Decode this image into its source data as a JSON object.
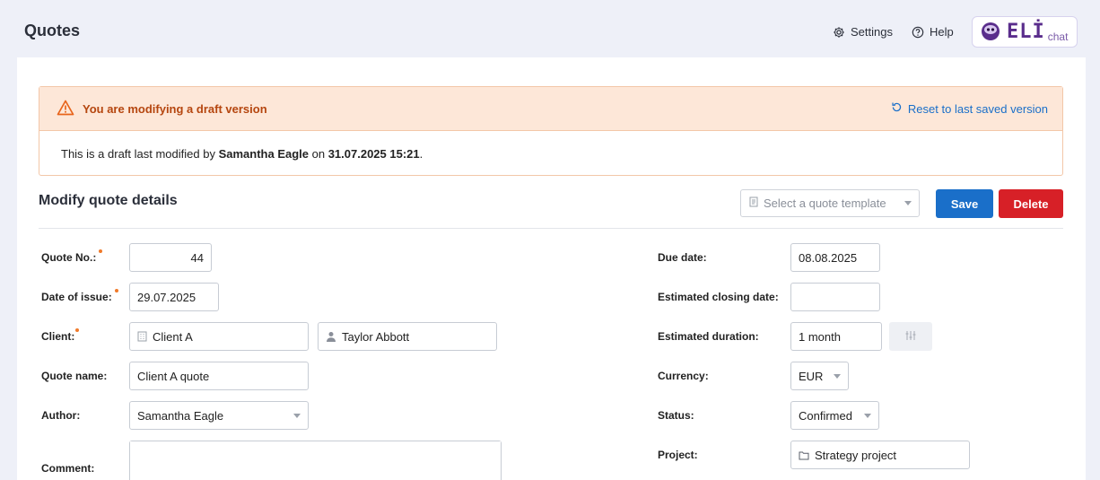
{
  "header": {
    "title": "Quotes",
    "settings_label": "Settings",
    "help_label": "Help",
    "eli_logo": "ELİ",
    "eli_chat": "chat"
  },
  "banner": {
    "title": "You are modifying a draft version",
    "reset_label": "Reset to last saved version",
    "body_prefix": "This is a draft last modified by ",
    "author": "Samantha Eagle",
    "body_mid": " on ",
    "timestamp": "31.07.2025 15:21",
    "body_suffix": "."
  },
  "section": {
    "title": "Modify quote details",
    "template_placeholder": "Select a quote template",
    "save_label": "Save",
    "delete_label": "Delete"
  },
  "form_left": {
    "quote_no_label": "Quote No.:",
    "quote_no_value": "44",
    "date_issue_label": "Date of issue:",
    "date_issue_value": "29.07.2025",
    "client_label": "Client:",
    "client_value": "Client A",
    "contact_value": "Taylor Abbott",
    "quote_name_label": "Quote name:",
    "quote_name_value": "Client A quote",
    "author_label": "Author:",
    "author_value": "Samantha Eagle",
    "comment_label": "Comment:"
  },
  "form_right": {
    "due_date_label": "Due date:",
    "due_date_value": "08.08.2025",
    "closing_label": "Estimated closing date:",
    "closing_value": "",
    "duration_label": "Estimated duration:",
    "duration_value": "1 month",
    "currency_label": "Currency:",
    "currency_value": "EUR",
    "status_label": "Status:",
    "status_value": "Confirmed",
    "project_label": "Project:",
    "project_value": "Strategy project"
  },
  "colors": {
    "primary": "#1a6fc9",
    "danger": "#d72027",
    "warning_bg": "#fde7d8",
    "warning_text": "#b5460f",
    "required_dot": "#f07a2a"
  },
  "icons": [
    "gear-icon",
    "help-icon",
    "eli-mascot-icon",
    "warning-icon",
    "undo-icon",
    "template-icon",
    "building-icon",
    "person-icon",
    "sliders-icon",
    "folder-icon"
  ]
}
